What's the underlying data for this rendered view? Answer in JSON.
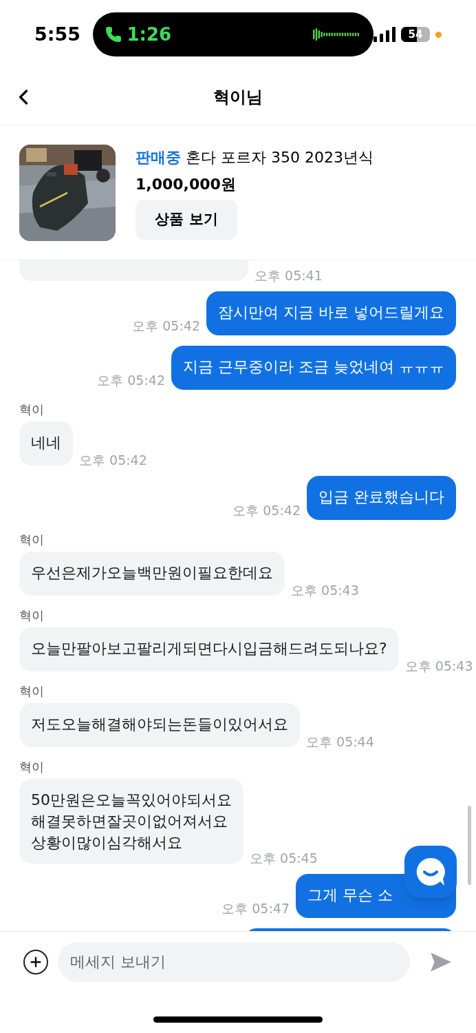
{
  "status_bar": {
    "time": "5:55",
    "call_timer": "1:26",
    "battery": "54"
  },
  "header": {
    "title": "혁이님"
  },
  "product": {
    "status": "판매중",
    "title": "혼다 포르자 350 2023년식",
    "price": "1,000,000원",
    "button": "상품 보기"
  },
  "messages": [
    {
      "kind": "incoming",
      "time": "오후 05:41"
    },
    {
      "kind": "outgoing",
      "lines": [
        "잠시만여 지금 바로 넣어드릴게요"
      ],
      "time": "오후 05:42"
    },
    {
      "kind": "outgoing",
      "lines": [
        "지금 근무중이라 조금 늦었네여 ㅠㅠㅠ"
      ],
      "time": "오후 05:42"
    },
    {
      "kind": "incoming",
      "sender": "혁이",
      "lines": [
        "네네"
      ],
      "time": "오후 05:42"
    },
    {
      "kind": "outgoing",
      "lines": [
        "입금 완료했습니다"
      ],
      "time": "오후 05:42"
    },
    {
      "kind": "incoming",
      "sender": "혁이",
      "lines": [
        "우선은제가오늘백만원이필요한데요"
      ],
      "time": "오후 05:43"
    },
    {
      "kind": "incoming",
      "sender": "혁이",
      "lines": [
        "오늘만팔아보고팔리게되면다시입금해드려도되나요?"
      ],
      "time": "오후 05:43"
    },
    {
      "kind": "incoming",
      "sender": "혁이",
      "lines": [
        "저도오늘해결해야되는돈들이있어서요"
      ],
      "time": "오후 05:44"
    },
    {
      "kind": "incoming",
      "sender": "혁이",
      "lines": [
        "50만원은오늘꼭있어야되서요",
        "해결못하면잘곳이없어져서요",
        "상황이많이심각해서요"
      ],
      "time": "오후 05:45"
    },
    {
      "kind": "outgoing",
      "lines": [
        "그게 무슨 소"
      ],
      "time": "오후 05:47",
      "partly_covered": true
    },
    {
      "kind": "outgoing"
    }
  ],
  "composer": {
    "placeholder": "메세지 보내기"
  }
}
